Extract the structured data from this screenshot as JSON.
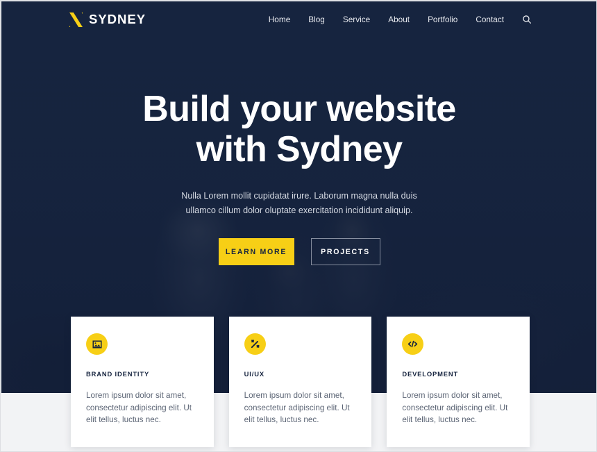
{
  "header": {
    "brand_name": "SYDNEY",
    "brand_icon": "sydney-logo-icon",
    "nav_items": [
      {
        "label": "Home"
      },
      {
        "label": "Blog"
      },
      {
        "label": "Service"
      },
      {
        "label": "About"
      },
      {
        "label": "Portfolio"
      },
      {
        "label": "Contact"
      }
    ],
    "search_icon": "search-icon"
  },
  "hero": {
    "title_line1": "Build your website",
    "title_line2": "with Sydney",
    "subtitle": "Nulla Lorem mollit cupidatat irure. Laborum magna nulla duis ullamco cillum dolor oluptate exercitation incididunt aliquip.",
    "primary_button": "LEARN MORE",
    "secondary_button": "PROJECTS"
  },
  "features": [
    {
      "icon": "image-icon",
      "title": "BRAND IDENTITY",
      "text": "Lorem ipsum dolor sit amet, consectetur adipiscing elit. Ut elit tellus, luctus nec."
    },
    {
      "icon": "magic-wand-icon",
      "title": "UI/UX",
      "text": "Lorem ipsum dolor sit amet, consectetur adipiscing elit. Ut elit tellus, luctus nec."
    },
    {
      "icon": "code-icon",
      "title": "DEVELOPMENT",
      "text": "Lorem ipsum dolor sit amet, consectetur adipiscing elit. Ut elit tellus, luctus nec."
    }
  ],
  "colors": {
    "navy": "#16243F",
    "yellow": "#F7CF16",
    "light_bg": "#F2F3F5",
    "card_bg": "#FFFFFF",
    "body_text": "#5C6575"
  }
}
